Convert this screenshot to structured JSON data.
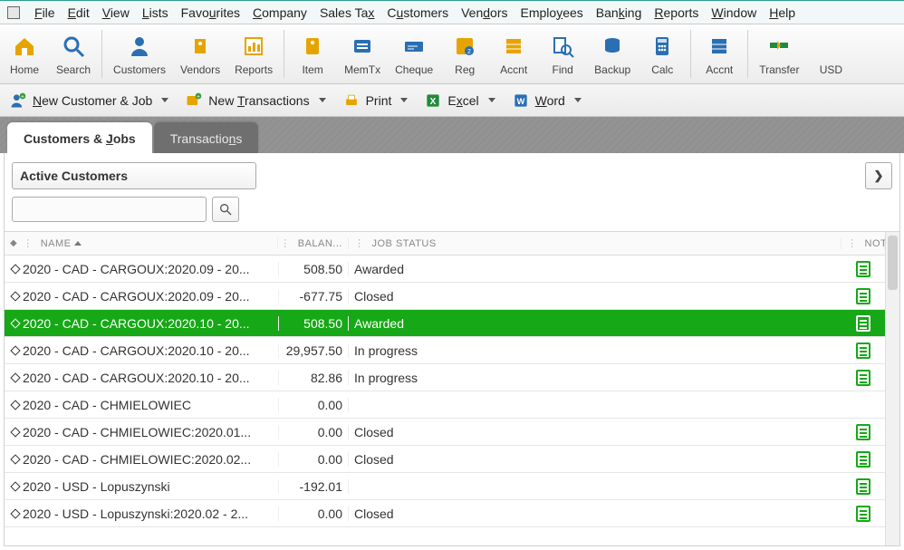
{
  "menu": [
    "File",
    "Edit",
    "View",
    "Lists",
    "Favourites",
    "Company",
    "Sales Tax",
    "Customers",
    "Vendors",
    "Employees",
    "Banking",
    "Reports",
    "Window",
    "Help"
  ],
  "menu_ul": [
    "F",
    "E",
    "V",
    "L",
    "u",
    "C",
    "x",
    "u",
    "d",
    "y",
    "k",
    "R",
    "W",
    "H"
  ],
  "toolbar": [
    {
      "id": "home",
      "label": "Home"
    },
    {
      "id": "search",
      "label": "Search"
    },
    {
      "id": "customers",
      "label": "Customers"
    },
    {
      "id": "vendors",
      "label": "Vendors"
    },
    {
      "id": "reports",
      "label": "Reports"
    },
    {
      "id": "item",
      "label": "Item"
    },
    {
      "id": "memtx",
      "label": "MemTx"
    },
    {
      "id": "cheque",
      "label": "Cheque"
    },
    {
      "id": "reg",
      "label": "Reg"
    },
    {
      "id": "accnt",
      "label": "Accnt"
    },
    {
      "id": "find",
      "label": "Find"
    },
    {
      "id": "backup",
      "label": "Backup"
    },
    {
      "id": "calc",
      "label": "Calc"
    },
    {
      "id": "accnt2",
      "label": "Accnt"
    },
    {
      "id": "transfer",
      "label": "Transfer"
    },
    {
      "id": "usd",
      "label": "USD"
    }
  ],
  "toolbar_separators_after": [
    1,
    4,
    12,
    13
  ],
  "subbar": {
    "new_customer": "New Customer & Job",
    "new_tx": "New Transactions",
    "print": "Print",
    "excel": "Excel",
    "word": "Word"
  },
  "tabs": {
    "active": "Customers & Jobs",
    "inactive": "Transactions"
  },
  "filter": {
    "selected": "Active Customers"
  },
  "search": {
    "value": ""
  },
  "columns": {
    "name": "NAME",
    "balance": "BALAN...",
    "job": "JOB STATUS",
    "note": "NOT..."
  },
  "rows": [
    {
      "name": "2020 - CAD - CARGOUX:2020.09 - 20...",
      "balance": "508.50",
      "job": "Awarded",
      "note": true,
      "selected": false
    },
    {
      "name": "2020 - CAD - CARGOUX:2020.09 - 20...",
      "balance": "-677.75",
      "job": "Closed",
      "note": true,
      "selected": false
    },
    {
      "name": "2020 - CAD - CARGOUX:2020.10 - 20...",
      "balance": "508.50",
      "job": "Awarded",
      "note": true,
      "selected": true
    },
    {
      "name": "2020 - CAD - CARGOUX:2020.10 - 20...",
      "balance": "29,957.50",
      "job": "In progress",
      "note": true,
      "selected": false
    },
    {
      "name": "2020 - CAD - CARGOUX:2020.10 - 20...",
      "balance": "82.86",
      "job": "In progress",
      "note": true,
      "selected": false
    },
    {
      "name": "2020 - CAD - CHMIELOWIEC",
      "balance": "0.00",
      "job": "",
      "note": false,
      "selected": false
    },
    {
      "name": "2020 - CAD - CHMIELOWIEC:2020.01...",
      "balance": "0.00",
      "job": "Closed",
      "note": true,
      "selected": false
    },
    {
      "name": "2020 - CAD - CHMIELOWIEC:2020.02...",
      "balance": "0.00",
      "job": "Closed",
      "note": true,
      "selected": false
    },
    {
      "name": "2020 - USD - Lopuszynski",
      "balance": "-192.01",
      "job": "",
      "note": true,
      "selected": false
    },
    {
      "name": "2020 - USD - Lopuszynski:2020.02 - 2...",
      "balance": "0.00",
      "job": "Closed",
      "note": true,
      "selected": false
    }
  ]
}
